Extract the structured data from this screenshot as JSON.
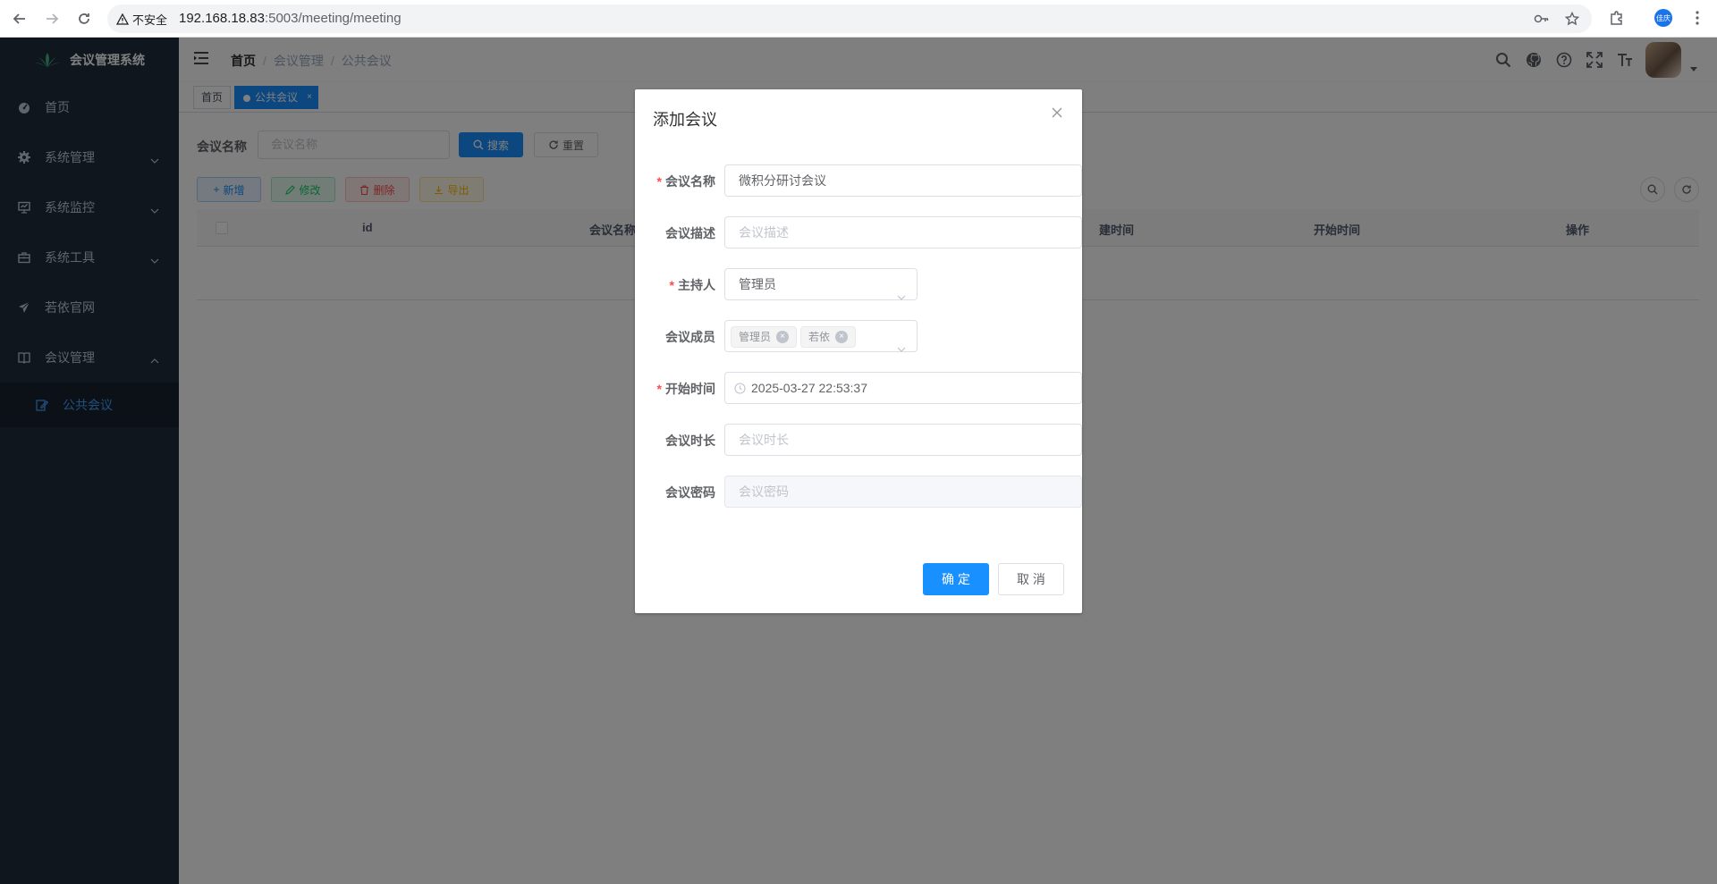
{
  "browser": {
    "security_label": "不安全",
    "url_host": "192.168.18.83",
    "url_rest": ":5003/meeting/meeting",
    "profile_label": "佳庆"
  },
  "sidebar": {
    "brand": "会议管理系统",
    "items": [
      {
        "label": "首页",
        "icon": "dashboard-icon"
      },
      {
        "label": "系统管理",
        "icon": "gear-icon"
      },
      {
        "label": "系统监控",
        "icon": "monitor-icon"
      },
      {
        "label": "系统工具",
        "icon": "toolbox-icon"
      },
      {
        "label": "若依官网",
        "icon": "send-icon"
      },
      {
        "label": "会议管理",
        "icon": "book-icon"
      }
    ],
    "sub_items": [
      {
        "label": "公共会议",
        "icon": "edit-icon"
      }
    ]
  },
  "navbar": {
    "breadcrumb": [
      "首页",
      "会议管理",
      "公共会议"
    ],
    "separator": "/"
  },
  "tags": {
    "items": [
      "首页",
      "公共会议"
    ],
    "close": "×"
  },
  "search": {
    "label": "会议名称",
    "placeholder": "会议名称",
    "search_button": "搜索",
    "reset_button": "重置"
  },
  "toolbar": {
    "add": "新增",
    "edit": "修改",
    "delete": "删除",
    "export": "导出"
  },
  "table": {
    "columns": [
      "id",
      "会议名称",
      "创建时间",
      "开始时间",
      "操作"
    ],
    "visible_headers": [
      "id",
      "会议名称",
      "建时间",
      "开始时间",
      "操作"
    ]
  },
  "dialog": {
    "title": "添加会议",
    "fields": {
      "name": {
        "label": "会议名称",
        "value": "微积分研讨会议",
        "required": true
      },
      "desc": {
        "label": "会议描述",
        "placeholder": "会议描述",
        "required": false
      },
      "host": {
        "label": "主持人",
        "value": "管理员",
        "required": true
      },
      "members": {
        "label": "会议成员",
        "values": [
          "管理员",
          "若依"
        ],
        "required": false
      },
      "start": {
        "label": "开始时间",
        "value": "2025-03-27 22:53:37",
        "required": true
      },
      "duration": {
        "label": "会议时长",
        "placeholder": "会议时长",
        "required": false
      },
      "password": {
        "label": "会议密码",
        "placeholder": "会议密码",
        "required": false
      }
    },
    "confirm": "确 定",
    "cancel": "取 消"
  },
  "colors": {
    "primary": "#1890ff",
    "sidebar_bg": "#1f2d3d",
    "required": "#ff4949"
  }
}
